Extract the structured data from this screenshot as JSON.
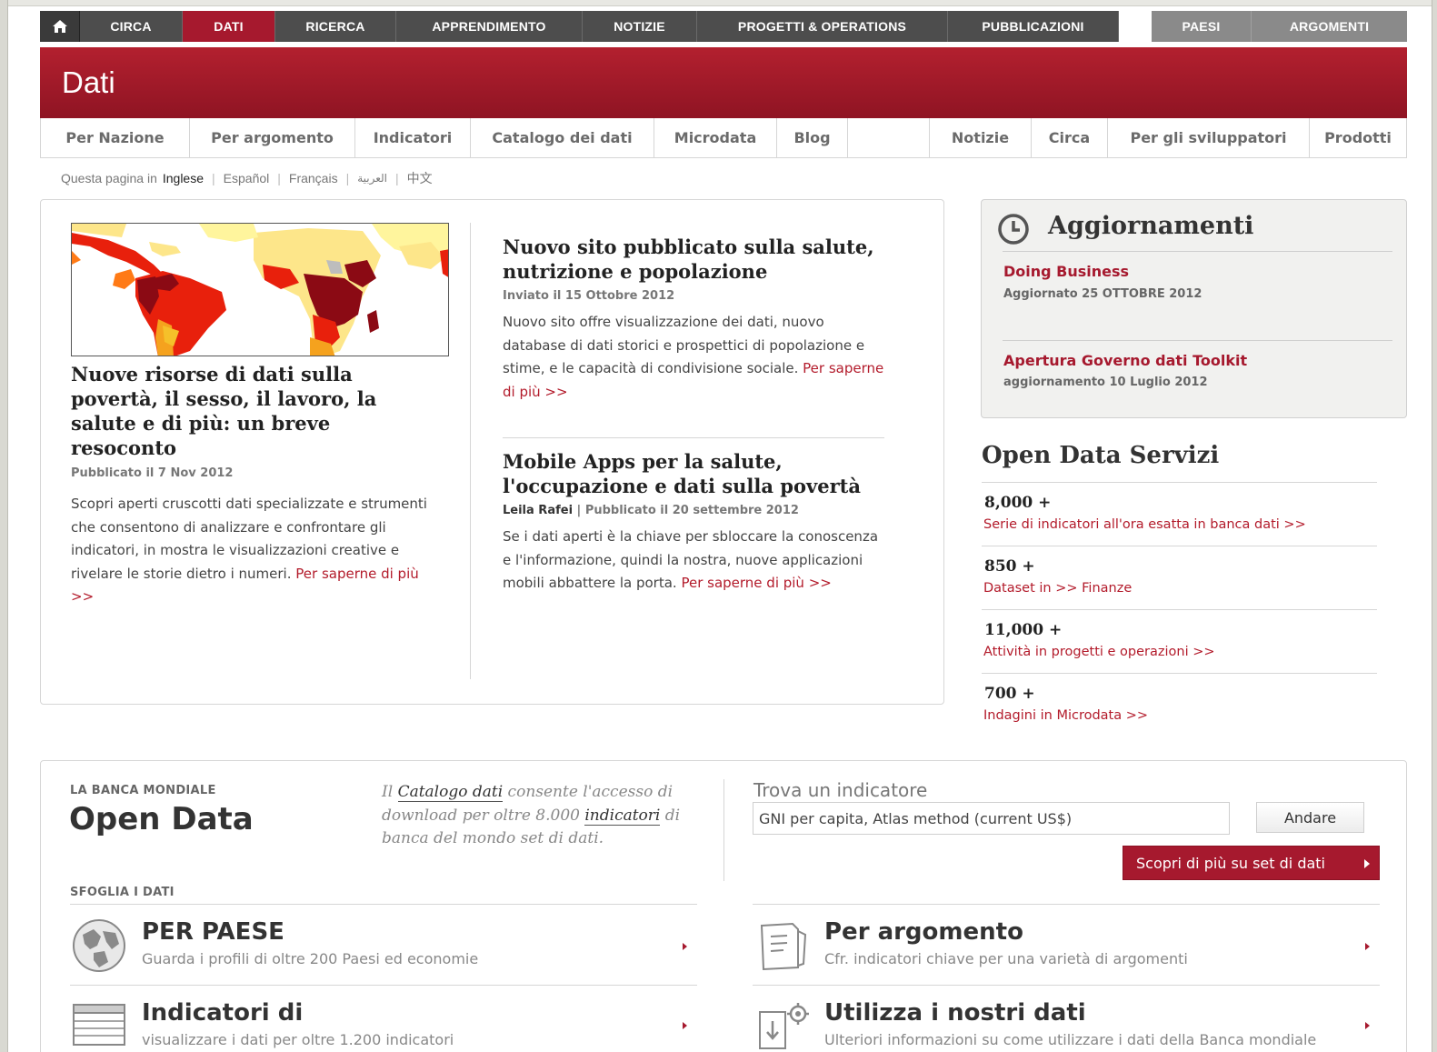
{
  "topnav": {
    "items": [
      "CIRCA",
      "DATI",
      "RICERCA",
      "APPRENDIMENTO",
      "NOTIZIE",
      "PROGETTI & OPERATIONS",
      "PUBBLICAZIONI",
      "PAESI",
      "ARGOMENTI"
    ],
    "active": "DATI"
  },
  "banner": {
    "title": "Dati"
  },
  "subnav": {
    "left": [
      "Per Nazione",
      "Per argomento",
      "Indicatori",
      "Catalogo dei dati",
      "Microdata",
      "Blog"
    ],
    "right": [
      "Notizie",
      "Circa",
      "Per gli sviluppatori",
      "Prodotti"
    ]
  },
  "langbar": {
    "prefix": "Questa pagina in",
    "current": "Inglese",
    "others": [
      "Español",
      "Français",
      "العربية",
      "中文"
    ]
  },
  "feature": {
    "title": "Nuove risorse di dati sulla povertà, il sesso, il lavoro, la salute e di più: un breve resoconto",
    "meta": "Pubblicato il 7 Nov 2012",
    "body": "Scopri aperti cruscotti dati specializzate e strumenti che consentono di analizzare e confrontare gli indicatori, in mostra le visualizzazioni creative e rivelare le storie dietro i numeri.",
    "link": "Per saperne di più >>"
  },
  "articles": [
    {
      "title": "Nuovo sito pubblicato sulla salute, nutrizione e popolazione",
      "meta": "Inviato il 15 Ottobre 2012",
      "author": "",
      "body": "Nuovo sito offre visualizzazione dei dati, nuovo database di dati storici e prospettici di popolazione e stime, e le capacità di condivisione sociale.",
      "link": "Per saperne di più >>"
    },
    {
      "title": "Mobile Apps per la salute, l'occupazione e dati sulla povertà",
      "author": "Leila Rafei",
      "meta": " | Pubblicato il 20 settembre 2012",
      "body": "Se i dati aperti è la chiave per sbloccare la conoscenza e l'informazione, quindi la nostra, nuove applicazioni mobili abbattere la porta.",
      "link": "Per saperne di più >>"
    }
  ],
  "updates": {
    "title": "Aggiornamenti",
    "items": [
      {
        "title": "Doing Business",
        "date": "Aggiornato 25 OTTOBRE 2012"
      },
      {
        "title": "Apertura Governo dati Toolkit",
        "date": "aggiornamento 10 Luglio 2012"
      }
    ]
  },
  "services": {
    "title": "Open Data Servizi",
    "items": [
      {
        "num": "8,000 +",
        "link": "Serie di indicatori all'ora esatta in banca dati >>"
      },
      {
        "num": "850 +",
        "link": "Dataset in >> Finanze"
      },
      {
        "num": "11,000 +",
        "link": "Attività in progetti e operazioni >>"
      },
      {
        "num": "700 +",
        "link": "Indagini in Microdata >>"
      }
    ]
  },
  "bottom": {
    "org": "LA BANCA MONDIALE",
    "name": "Open Data",
    "catalog_pre": "Il ",
    "catalog_link": "Catalogo dati",
    "catalog_mid": " consente l'accesso di download per oltre 8.000 ",
    "catalog_link2": "indicatori",
    "catalog_post": " di banca del mondo set di dati.",
    "find_label": "Trova un indicatore",
    "find_value": "GNI per capita, Atlas method (current US$)",
    "go": "Andare",
    "more": "Scopri di più su set di dati",
    "browse": "SFOGLIA I DATI",
    "tiles": [
      {
        "title": "PER PAESE",
        "sub": "Guarda i profili di oltre 200 Paesi ed economie",
        "icon": "globe-icon"
      },
      {
        "title": "Per argomento",
        "sub": "Cfr. indicatori chiave per una varietà di argomenti",
        "icon": "document-icon"
      },
      {
        "title": "Indicatori di",
        "sub": "visualizzare i dati per oltre 1.200 indicatori",
        "icon": "table-icon"
      },
      {
        "title": "Utilizza i nostri dati",
        "sub": "Ulteriori informazioni su come utilizzare i dati della Banca mondiale",
        "icon": "download-gear-icon"
      }
    ]
  },
  "colors": {
    "brand_red": "#a6192e",
    "nav_dark": "#4d4d4d",
    "nav_grey": "#8a8a8a",
    "link_red": "#b31b2b"
  }
}
